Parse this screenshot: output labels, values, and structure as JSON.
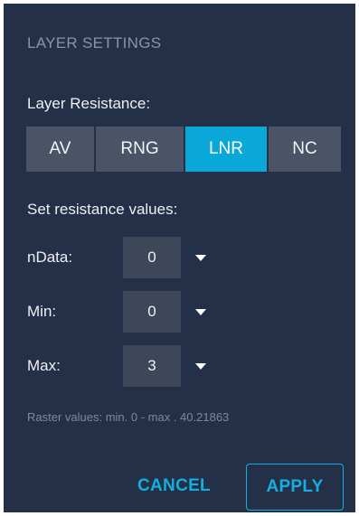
{
  "dialog": {
    "title": "LAYER SETTINGS",
    "resistance_label": "Layer Resistance:",
    "resistance_options": [
      {
        "label": "AV",
        "selected": false
      },
      {
        "label": "RNG",
        "selected": false
      },
      {
        "label": "LNR",
        "selected": true
      },
      {
        "label": "NC",
        "selected": false
      }
    ],
    "values_label": "Set resistance values:",
    "fields": [
      {
        "label": "nData:",
        "value": "0"
      },
      {
        "label": "Min:",
        "value": "0"
      },
      {
        "label": "Max:",
        "value": "3"
      }
    ],
    "raster_info": "Raster values: min. 0 - max . 40.21863",
    "cancel_label": "CANCEL",
    "apply_label": "APPLY"
  },
  "colors": {
    "panel_background": "#243048",
    "segment_inactive": "#4b5366",
    "segment_active": "#0aa7d9",
    "field_background": "#3e475a",
    "accent": "#14aee0",
    "muted_text": "#7f889b"
  },
  "icons": {
    "dropdown": "caret-down-icon"
  }
}
